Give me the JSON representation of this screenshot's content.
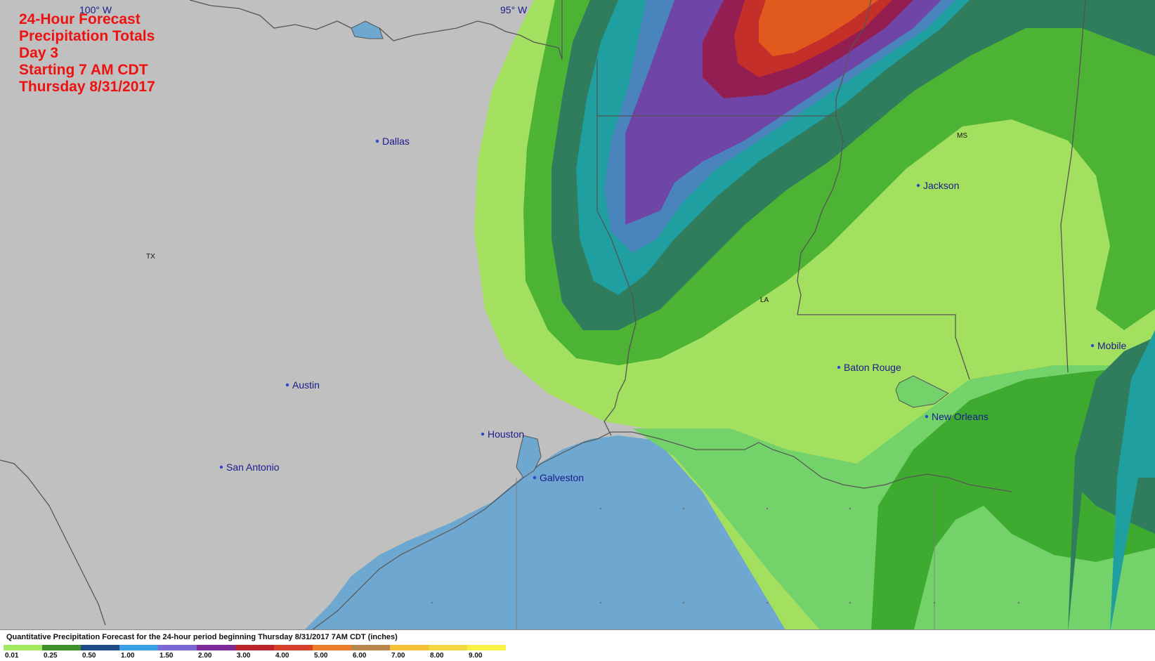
{
  "title": {
    "line1": "24-Hour Forecast",
    "line2": "Precipitation Totals",
    "line3": "Day 3",
    "line4": "Starting 7 AM CDT",
    "line5": "Thursday 8/31/2017"
  },
  "longitude_labels": [
    "100° W",
    "95° W"
  ],
  "state_labels": [
    "TX",
    "LA",
    "MS"
  ],
  "cities": [
    {
      "name": "Dallas"
    },
    {
      "name": "Austin"
    },
    {
      "name": "San Antonio"
    },
    {
      "name": "Houston"
    },
    {
      "name": "Galveston"
    },
    {
      "name": "Jackson"
    },
    {
      "name": "Baton Rouge"
    },
    {
      "name": "New Orleans"
    },
    {
      "name": "Mobile"
    }
  ],
  "legend": {
    "caption": "Quantitative Precipitation Forecast for the 24-hour period beginning Thursday 8/31/2017 7AM CDT (inches)",
    "items": [
      {
        "label": "0.01",
        "color": "#a3e860"
      },
      {
        "label": "0.25",
        "color": "#3f8f2a"
      },
      {
        "label": "0.50",
        "color": "#1f4b86"
      },
      {
        "label": "1.00",
        "color": "#3a9ee6"
      },
      {
        "label": "1.50",
        "color": "#7b68d6"
      },
      {
        "label": "2.00",
        "color": "#7a2a96"
      },
      {
        "label": "3.00",
        "color": "#b8252a"
      },
      {
        "label": "4.00",
        "color": "#d6402a"
      },
      {
        "label": "5.00",
        "color": "#ef7b2c"
      },
      {
        "label": "6.00",
        "color": "#b8864a"
      },
      {
        "label": "7.00",
        "color": "#f5c03a"
      },
      {
        "label": "8.00",
        "color": "#f5d740"
      },
      {
        "label": "9.00",
        "color": "#f8f346"
      }
    ]
  }
}
